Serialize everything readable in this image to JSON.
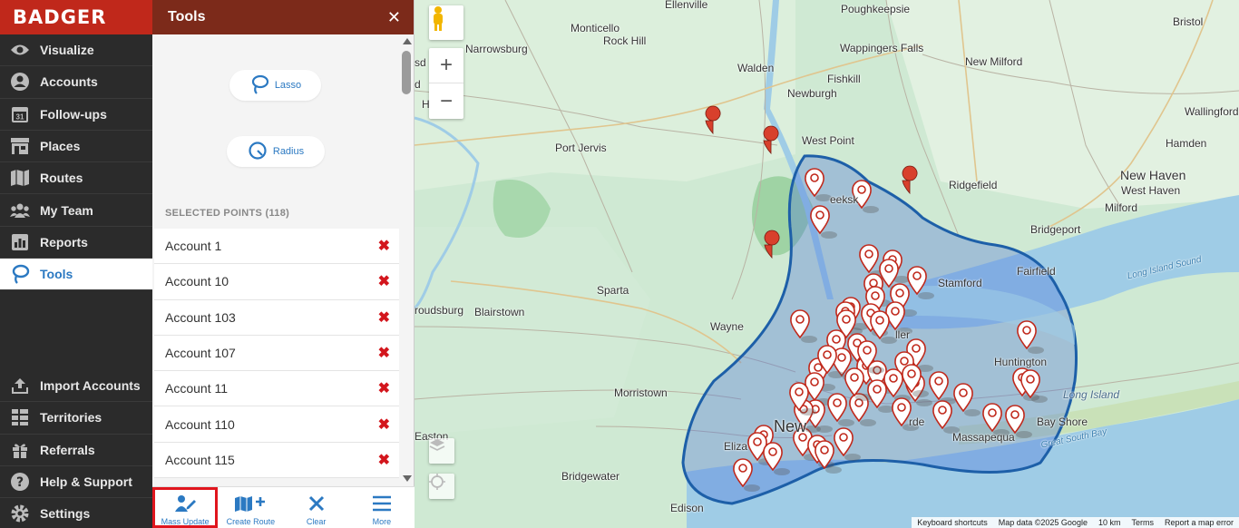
{
  "brand": {
    "name": "BADGER",
    "color": "#c0281b"
  },
  "nav": {
    "top_items": [
      {
        "label": "Visualize",
        "icon": "eye-icon"
      },
      {
        "label": "Accounts",
        "icon": "person-circle-icon"
      },
      {
        "label": "Follow-ups",
        "icon": "calendar-icon",
        "icon_text": "31"
      },
      {
        "label": "Places",
        "icon": "storefront-icon"
      },
      {
        "label": "Routes",
        "icon": "map-icon"
      },
      {
        "label": "My Team",
        "icon": "team-icon"
      },
      {
        "label": "Reports",
        "icon": "report-chart-icon"
      },
      {
        "label": "Tools",
        "icon": "lasso-icon",
        "active": true
      }
    ],
    "bottom_items": [
      {
        "label": "Import Accounts",
        "icon": "upload-icon"
      },
      {
        "label": "Territories",
        "icon": "grid-icon"
      },
      {
        "label": "Referrals",
        "icon": "gift-icon"
      },
      {
        "label": "Help & Support",
        "icon": "question-icon"
      },
      {
        "label": "Settings",
        "icon": "gear-icon"
      }
    ]
  },
  "panel": {
    "title": "Tools",
    "lasso_label": "Lasso",
    "radius_label": "Radius",
    "selected_header": "SELECTED POINTS (118)",
    "accounts": [
      "Account 1",
      "Account 10",
      "Account 103",
      "Account 107",
      "Account 11",
      "Account 110",
      "Account 115"
    ],
    "remove_glyph": "✖",
    "bottom_bar": [
      {
        "label": "Mass Update",
        "icon": "mass-update-icon",
        "highlighted": true
      },
      {
        "label": "Create Route",
        "icon": "create-route-icon"
      },
      {
        "label": "Clear",
        "icon": "clear-icon"
      },
      {
        "label": "More",
        "icon": "menu-icon"
      }
    ]
  },
  "map": {
    "labels": {
      "ellenville": "Ellenville",
      "poughkeepsie": "Poughkeepsie",
      "bristol": "Bristol",
      "monticello": "Monticello",
      "rock_hill": "Rock Hill",
      "wappingers_falls": "Wappingers Falls",
      "narrowsburg": "Narrowsburg",
      "fishkill": "Fishkill",
      "new_milford": "New Milford",
      "walden": "Walden",
      "newburgh": "Newburgh",
      "wallingford": "Wallingford",
      "hamden": "Hamden",
      "port_jervis": "Port Jervis",
      "west_point": "West Point",
      "new_haven": "New Haven",
      "west_haven": "West Haven",
      "ridgefield": "Ridgefield",
      "milford": "Milford",
      "peekskill": "eeksk",
      "bridgeport": "Bridgeport",
      "fairfield": "Fairfield",
      "long_island_sound": "Long Island Sound",
      "stamford": "Stamford",
      "sparta": "Sparta",
      "stroudsburg": "roudsburg",
      "blairstown": "Blairstown",
      "wayne": "Wayne",
      "huntington": "Huntington",
      "long_island": "Long Island",
      "morristown": "Morristown",
      "new_york": "New",
      "bay_shore": "Bay Shore",
      "massapequa": "Massapequa",
      "great_south_bay": "Great South Bay",
      "easton": "Easton",
      "elizabeth": "Eliza",
      "bridgewater": "Bridgewater",
      "edison": "Edison",
      "lbl_hi": "Hi",
      "lbl_sd": "sd",
      "lbl_d": "d",
      "lbl_ller": "ller",
      "lbl_rde": "rde"
    },
    "attribution": {
      "shortcuts": "Keyboard shortcuts",
      "data": "Map data ©2025 Google",
      "scale": "10 km",
      "terms": "Terms",
      "report": "Report a map error"
    },
    "accent_color": "#2b79c2",
    "lasso_color": "#1d5fa8",
    "pin_color": "#d8402c"
  }
}
